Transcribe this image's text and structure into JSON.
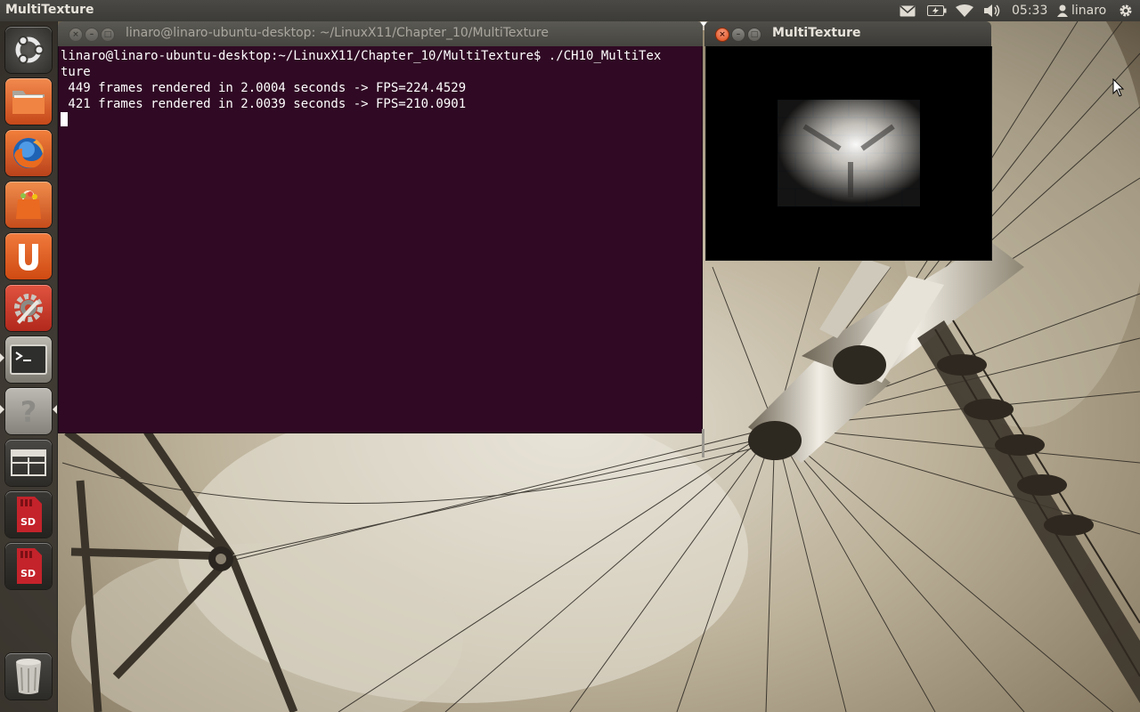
{
  "panel": {
    "app_title": "MultiTexture",
    "clock": "05:33",
    "user": "linaro",
    "indicators": [
      "mail-icon",
      "battery-icon",
      "wifi-icon",
      "volume-icon",
      "user-icon",
      "gear-icon"
    ]
  },
  "launcher": {
    "items": [
      {
        "name": "dash-home",
        "icon": "ubuntu-logo-icon"
      },
      {
        "name": "home-folder",
        "icon": "folder-icon"
      },
      {
        "name": "firefox",
        "icon": "firefox-icon"
      },
      {
        "name": "software-center",
        "icon": "shopping-bag-icon"
      },
      {
        "name": "ubuntu-one",
        "icon": "ubuntu-one-icon"
      },
      {
        "name": "system-settings",
        "icon": "settings-icon"
      },
      {
        "name": "terminal",
        "icon": "terminal-icon",
        "running": true
      },
      {
        "name": "help",
        "icon": "help-icon",
        "running": true
      },
      {
        "name": "workspace-switcher",
        "icon": "workspaces-icon"
      },
      {
        "name": "sd-card-1",
        "icon": "sd-card-icon",
        "label": "SD"
      },
      {
        "name": "sd-card-2",
        "icon": "sd-card-icon",
        "label": "SD"
      },
      {
        "name": "trash",
        "icon": "trash-icon"
      }
    ]
  },
  "terminal": {
    "title": "linaro@linaro-ubuntu-desktop: ~/LinuxX11/Chapter_10/MultiTexture",
    "lines": [
      "linaro@linaro-ubuntu-desktop:~/LinuxX11/Chapter_10/MultiTexture$ ./CH10_MultiTex",
      "ture",
      " 449 frames rendered in 2.0004 seconds -> FPS=224.4529",
      " 421 frames rendered in 2.0039 seconds -> FPS=210.0901"
    ],
    "colors": {
      "background": "#300a24",
      "text": "#ffffff"
    }
  },
  "multitexture": {
    "title": "MultiTexture"
  },
  "sd_label": "SD"
}
